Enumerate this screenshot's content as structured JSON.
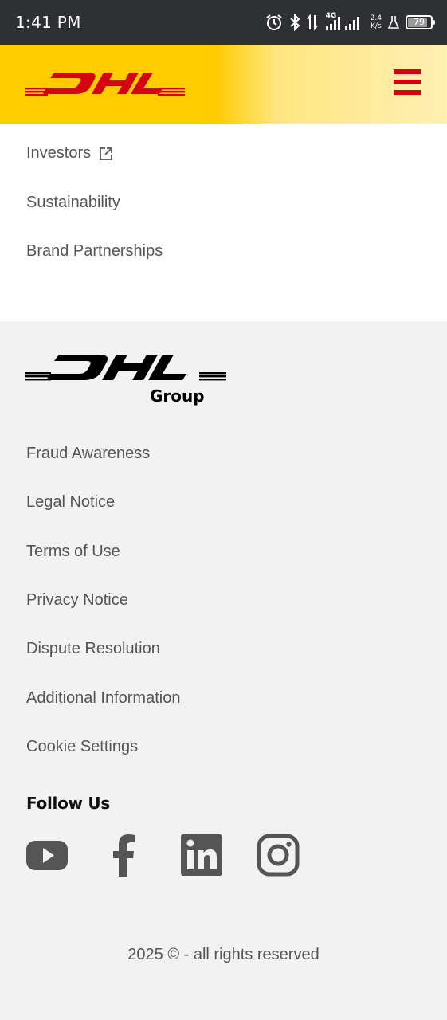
{
  "status_bar": {
    "time": "1:41 PM",
    "network": "4G",
    "speed_value": "2.4",
    "speed_unit": "K/s",
    "battery": "79"
  },
  "header": {
    "logo_alt": "DHL",
    "logo_icon": "dhl-logo",
    "menu_icon": "hamburger-menu-icon",
    "brand_red": "#d40511",
    "brand_yellow": "#ffcc00"
  },
  "nav": {
    "items": [
      {
        "label": "Investors",
        "external": true
      },
      {
        "label": "Sustainability"
      },
      {
        "label": "Brand Partnerships"
      }
    ]
  },
  "footer": {
    "group_logo_text": "Group",
    "links": [
      {
        "label": "Fraud Awareness"
      },
      {
        "label": "Legal Notice"
      },
      {
        "label": "Terms of Use"
      },
      {
        "label": "Privacy Notice"
      },
      {
        "label": "Dispute Resolution"
      },
      {
        "label": "Additional Information"
      },
      {
        "label": "Cookie Settings"
      }
    ],
    "follow_title": "Follow Us",
    "social": [
      "youtube-icon",
      "facebook-icon",
      "linkedin-icon",
      "instagram-icon"
    ],
    "copyright": "2025 © - all rights reserved"
  }
}
